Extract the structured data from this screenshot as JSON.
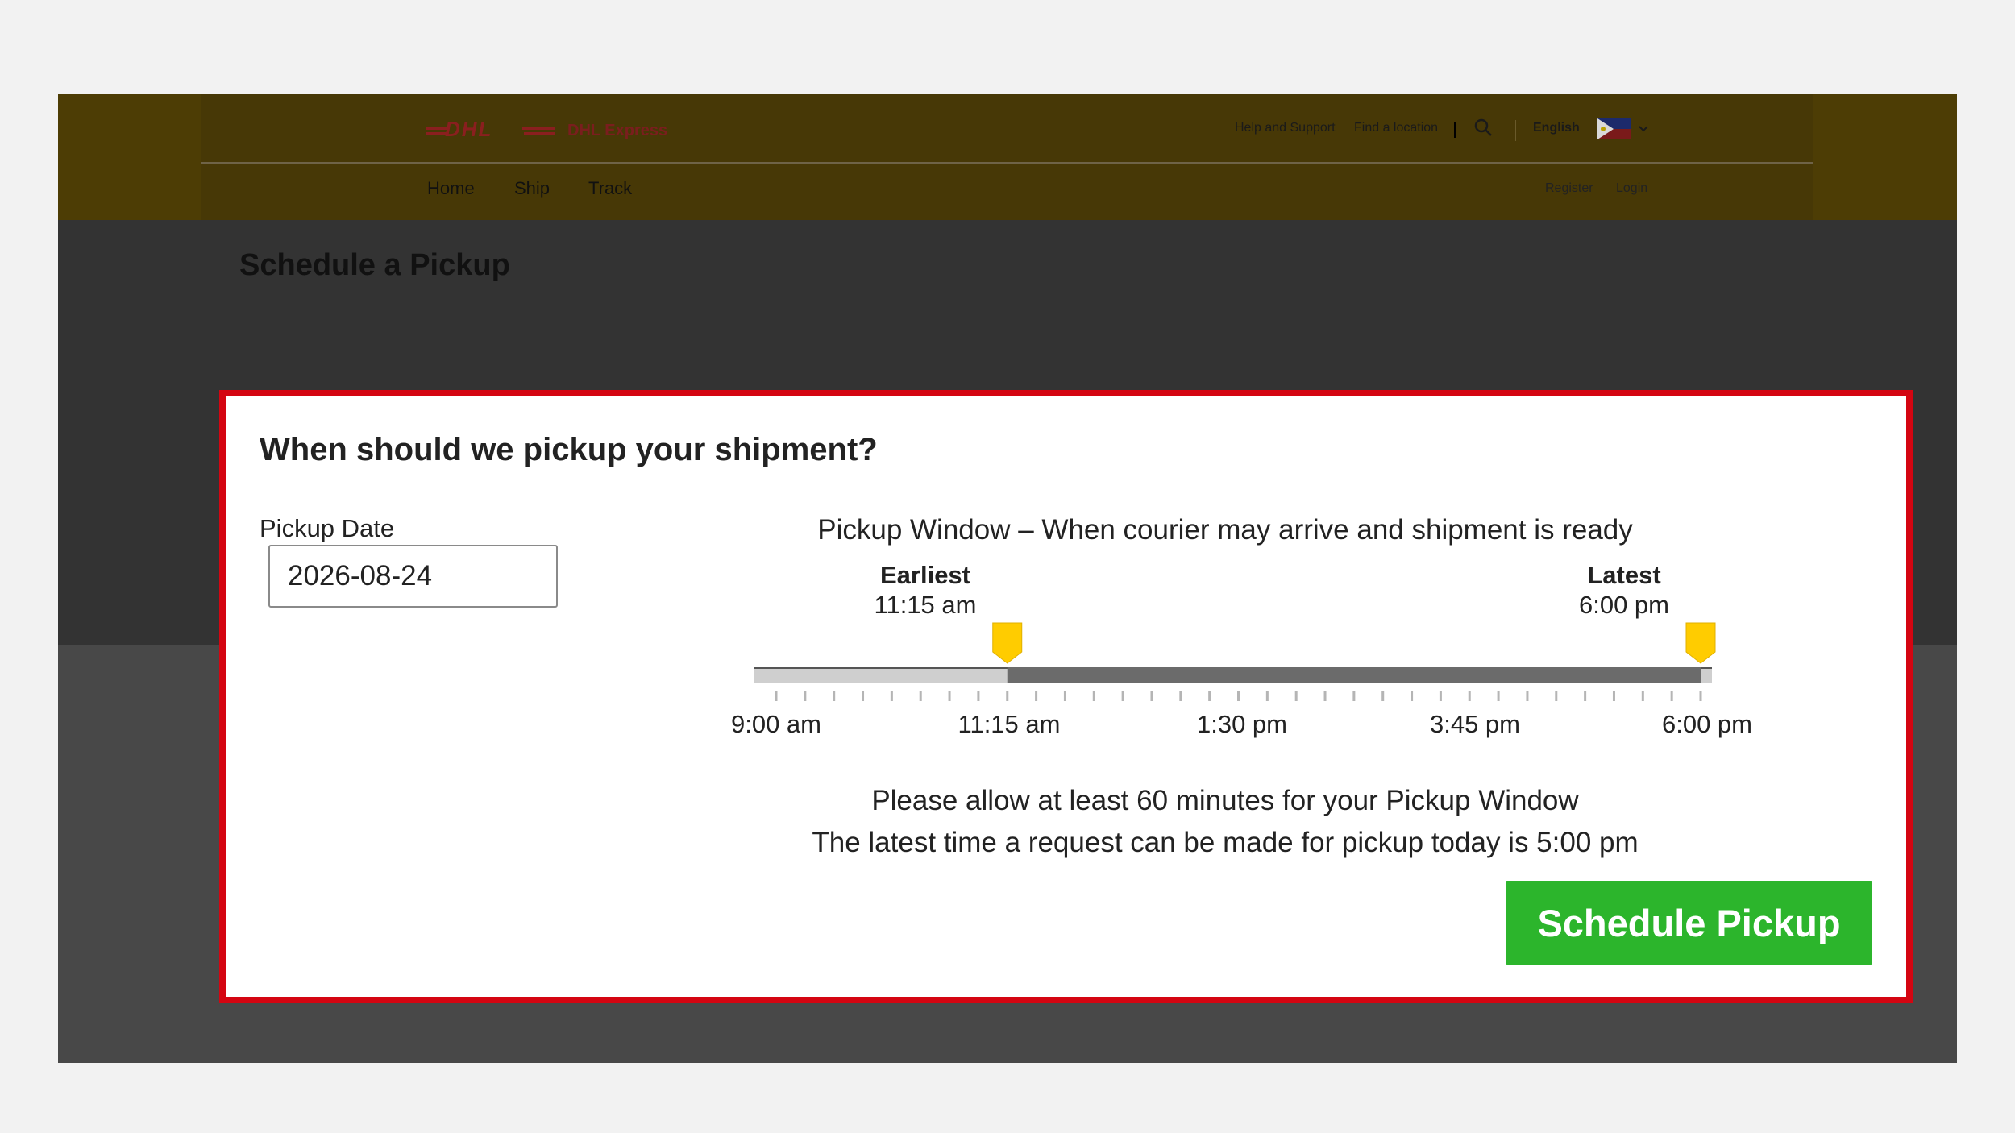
{
  "header": {
    "brand_text": "DHL Express",
    "logo_text": "DHL",
    "utility_links": [
      "Help and Support",
      "Find a location"
    ],
    "language": "English",
    "nav": [
      "Home",
      "Ship",
      "Track"
    ],
    "account_links": [
      "Register",
      "Login"
    ]
  },
  "page": {
    "title": "Schedule a Pickup"
  },
  "modal": {
    "question": "When should we pickup your shipment?",
    "date_label": "Pickup Date",
    "date_value": "2026-08-24",
    "window_title": "Pickup Window – When courier may arrive and shipment is ready",
    "earliest": {
      "label": "Earliest",
      "time": "11:15 am"
    },
    "latest": {
      "label": "Latest",
      "time": "6:00 pm"
    },
    "range_start_fraction": 0.25,
    "range_end_fraction": 1.0,
    "tick_labels": [
      "9:00 am",
      "11:15 am",
      "1:30 pm",
      "3:45 pm",
      "6:00 pm"
    ],
    "notes": [
      "Please allow at least 60 minutes for your Pickup Window",
      "The latest time a request can be made for pickup today is 5:00 pm"
    ],
    "button_label": "Schedule Pickup"
  },
  "colors": {
    "accent_red": "#d40511",
    "marker_yellow": "#ffcc00",
    "button_green": "#2cb52c"
  }
}
